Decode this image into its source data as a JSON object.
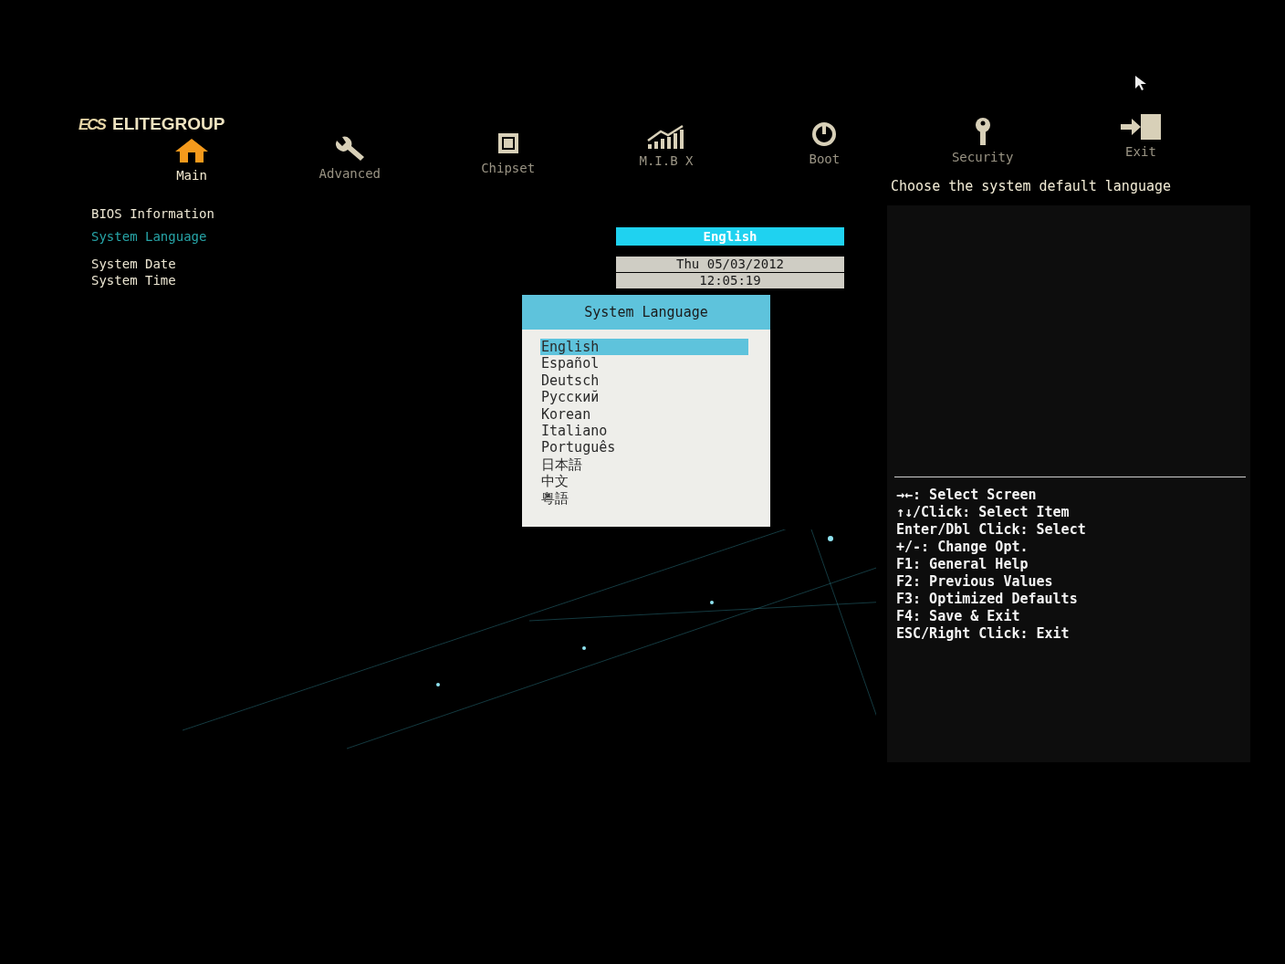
{
  "brand": {
    "mark": "ECS",
    "name": "ELITEGROUP"
  },
  "tabs": [
    {
      "label": "Main",
      "selected": true
    },
    {
      "label": "Advanced",
      "selected": false
    },
    {
      "label": "Chipset",
      "selected": false
    },
    {
      "label": "M.I.B X",
      "selected": false
    },
    {
      "label": "Boot",
      "selected": false
    },
    {
      "label": "Security",
      "selected": false
    },
    {
      "label": "Exit",
      "selected": false
    }
  ],
  "items": [
    {
      "label": "BIOS Information",
      "selected": false
    },
    {
      "label": "System Language",
      "selected": true,
      "value": "English",
      "kind": "choice"
    },
    {
      "label": "System Date",
      "selected": false,
      "value": "Thu 05/03/2012",
      "kind": "field"
    },
    {
      "label": "System Time",
      "selected": false,
      "value": "12:05:19",
      "kind": "field"
    }
  ],
  "help_text": "Choose the system default language",
  "key_legend": [
    "→←: Select Screen",
    "↑↓/Click: Select Item",
    "Enter/Dbl Click: Select",
    "+/-: Change Opt.",
    "F1: General Help",
    "F2: Previous Values",
    "F3: Optimized Defaults",
    "F4: Save & Exit",
    "ESC/Right Click: Exit"
  ],
  "popup": {
    "title": "System Language",
    "options": [
      {
        "label": "English",
        "selected": true
      },
      {
        "label": "Español",
        "selected": false
      },
      {
        "label": "Deutsch",
        "selected": false
      },
      {
        "label": "Русский",
        "selected": false
      },
      {
        "label": "Korean",
        "selected": false
      },
      {
        "label": "Italiano",
        "selected": false
      },
      {
        "label": "Português",
        "selected": false
      },
      {
        "label": "日本語",
        "selected": false
      },
      {
        "label": "中文",
        "selected": false
      },
      {
        "label": "粵語",
        "selected": false
      }
    ]
  }
}
